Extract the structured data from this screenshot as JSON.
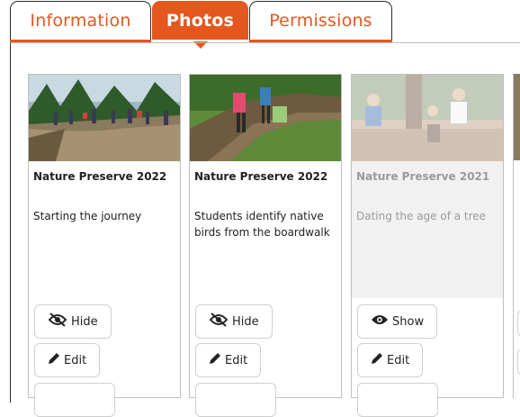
{
  "tabs": [
    {
      "label": "Information",
      "active": false
    },
    {
      "label": "Photos",
      "active": true
    },
    {
      "label": "Permissions",
      "active": false
    }
  ],
  "colors": {
    "accent": "#e4571e",
    "hidden_bg": "#f1f1f1"
  },
  "photos": [
    {
      "title": "Nature Preserve 2022",
      "caption": "Starting the journey",
      "visible": true,
      "toggle_label": "Hide",
      "toggle_icon": "eye-slash-icon",
      "edit_label": "Edit"
    },
    {
      "title": "Nature Preserve 2022",
      "caption": "Students identify native birds from the boardwalk",
      "visible": true,
      "toggle_label": "Hide",
      "toggle_icon": "eye-slash-icon",
      "edit_label": "Edit"
    },
    {
      "title": "Nature Preserve 2021",
      "caption": "Dating the age of a tree",
      "visible": false,
      "toggle_label": "Show",
      "toggle_icon": "eye-icon",
      "edit_label": "Edit"
    }
  ]
}
